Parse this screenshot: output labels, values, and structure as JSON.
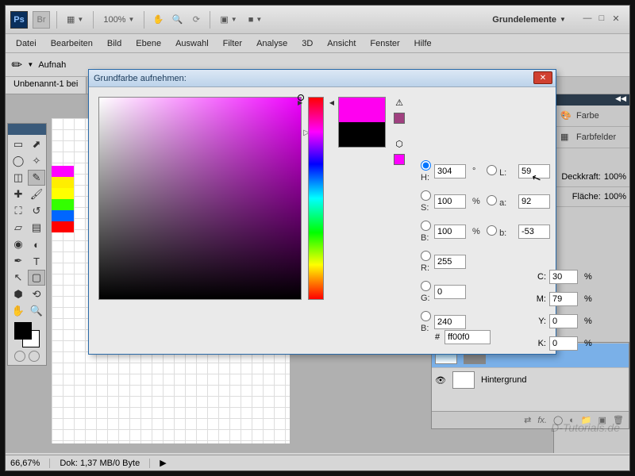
{
  "top": {
    "ps": "Ps",
    "br": "Br",
    "zoom": "100%",
    "workspace": "Grundelemente"
  },
  "menu": [
    "Datei",
    "Bearbeiten",
    "Bild",
    "Ebene",
    "Auswahl",
    "Filter",
    "Analyse",
    "3D",
    "Ansicht",
    "Fenster",
    "Hilfe"
  ],
  "options": {
    "sample_label": "Aufnah"
  },
  "doc_tab": "Unbenannt-1 bei",
  "panels": {
    "farbe": "Farbe",
    "farbfelder": "Farbfelder",
    "opacity_label": "Deckkraft:",
    "opacity_val": "100%",
    "fill_label": "Fläche:",
    "fill_val": "100%"
  },
  "layer": {
    "name": "Hintergrund"
  },
  "status": {
    "zoom": "66,67%",
    "doc": "Dok: 1,37 MB/0 Byte"
  },
  "watermark": "D-Tutorials.de",
  "dialog": {
    "title": "Grundfarbe aufnehmen:",
    "H_label": "H:",
    "H_val": "304",
    "H_unit": "°",
    "S_label": "S:",
    "S_val": "100",
    "S_unit": "%",
    "B_label": "B:",
    "B_val": "100",
    "B_unit": "%",
    "R_label": "R:",
    "R_val": "255",
    "G_label": "G:",
    "G_val": "0",
    "Bb_label": "B:",
    "Bb_val": "240",
    "L_label": "L:",
    "L_val": "59",
    "a_label": "a:",
    "a_val": "92",
    "b_label": "b:",
    "b_val": "-53",
    "C_label": "C:",
    "C_val": "30",
    "M_label": "M:",
    "M_val": "79",
    "Y_label": "Y:",
    "Y_val": "0",
    "K_label": "K:",
    "K_val": "0",
    "pct": "%",
    "hex_label": "#",
    "hex_val": "ff00f0"
  },
  "canvas_rows": [
    "#ff00ff",
    "#ffee00",
    "#ffff00",
    "#33ff00",
    "#0066ff",
    "#ff0000"
  ]
}
